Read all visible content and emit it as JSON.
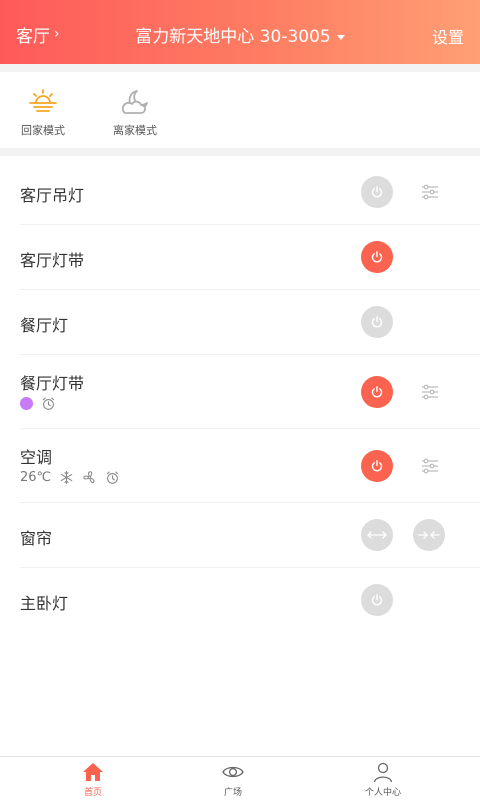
{
  "header": {
    "room_label": "客厅",
    "room_chevron": "›",
    "title": "富力新天地中心 30-3005",
    "settings_label": "设置"
  },
  "modes": [
    {
      "label": "回家模式",
      "icon": "sunrise-icon"
    },
    {
      "label": "离家模式",
      "icon": "moon-cloud-icon"
    }
  ],
  "devices": [
    {
      "name": "客厅吊灯",
      "power": "off",
      "adjust": true
    },
    {
      "name": "客厅灯带",
      "power": "on",
      "adjust": false
    },
    {
      "name": "餐厅灯",
      "power": "off",
      "adjust": false
    },
    {
      "name": "餐厅灯带",
      "power": "on",
      "adjust": true,
      "sub": {
        "color": "#c77cf5",
        "timer_icon": "alarm-clock-icon"
      }
    },
    {
      "name": "空调",
      "power": "on",
      "adjust": true,
      "sub": {
        "temperature": "26℃",
        "icons": [
          "snowflake-icon",
          "fan-icon",
          "alarm-clock-icon"
        ]
      }
    },
    {
      "name": "窗帘",
      "controls": [
        "curtain-open-icon",
        "curtain-close-icon"
      ]
    },
    {
      "name": "主卧灯",
      "power": "off",
      "adjust": false
    }
  ],
  "tabs": [
    {
      "label": "首页",
      "icon": "home-icon",
      "active": true
    },
    {
      "label": "广场",
      "icon": "eye-icon",
      "active": false
    },
    {
      "label": "个人中心",
      "icon": "person-icon",
      "active": false
    }
  ],
  "colors": {
    "accent": "#f9634f",
    "header_gradient_start": "#fe5a5a",
    "header_gradient_end": "#ff9f76",
    "power_off": "#dcdcdc"
  }
}
